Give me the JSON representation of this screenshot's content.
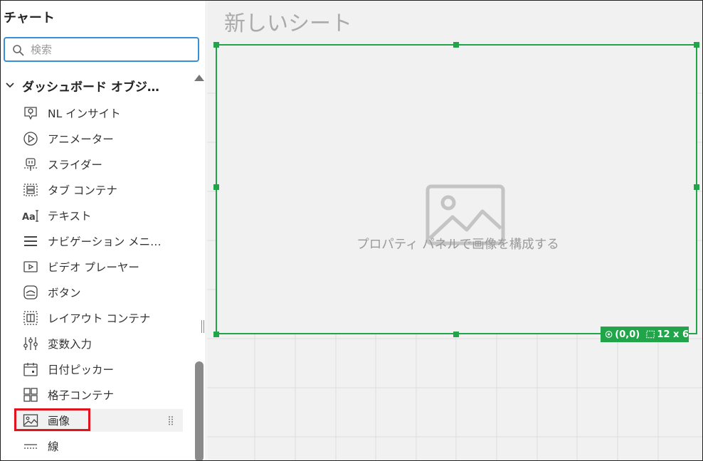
{
  "sidebar": {
    "title": "チャート",
    "search": {
      "placeholder": "検索",
      "value": ""
    },
    "section": {
      "label": "ダッシュボード オブジ…"
    },
    "items": [
      {
        "label": "NL インサイト",
        "icon": "nl-insight-icon"
      },
      {
        "label": "アニメーター",
        "icon": "play-circle-icon"
      },
      {
        "label": "スライダー",
        "icon": "slider-icon"
      },
      {
        "label": "タブ コンテナ",
        "icon": "tab-container-icon"
      },
      {
        "label": "テキスト",
        "icon": "text-aa-icon"
      },
      {
        "label": "ナビゲーション メニ…",
        "icon": "hamburger-menu-icon"
      },
      {
        "label": "ビデオ プレーヤー",
        "icon": "video-player-icon"
      },
      {
        "label": "ボタン",
        "icon": "button-icon"
      },
      {
        "label": "レイアウト コンテナ",
        "icon": "layout-container-icon"
      },
      {
        "label": "変数入力",
        "icon": "variable-input-icon"
      },
      {
        "label": "日付ピッカー",
        "icon": "calendar-icon"
      },
      {
        "label": "格子コンテナ",
        "icon": "grid-container-icon"
      },
      {
        "label": "画像",
        "icon": "image-icon",
        "selected": true
      },
      {
        "label": "線",
        "icon": "line-icon"
      }
    ]
  },
  "canvas": {
    "sheet_title": "新しいシート",
    "image_object": {
      "placeholder_text": "プロパティ パネルで画像を構成する",
      "position_label": "(0,0)",
      "size_label": "12 x 6"
    }
  },
  "colors": {
    "accent_green": "#22a54a",
    "search_focus": "#3a8ed6",
    "highlight_red": "#e0141e",
    "canvas_bg": "#f1f1f1"
  }
}
